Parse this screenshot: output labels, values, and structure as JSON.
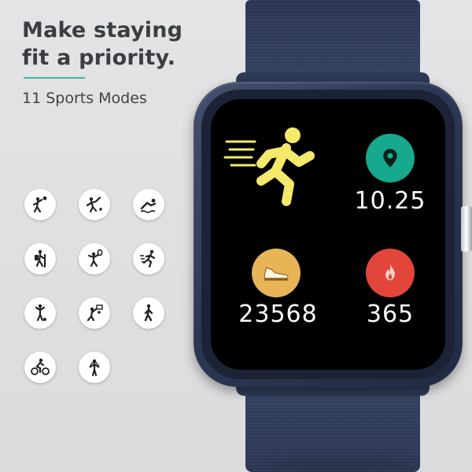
{
  "headline_line1": "Make staying",
  "headline_line2": "fit a priority.",
  "subtitle": "11 Sports Modes",
  "colors": {
    "accent_line": "#3bb3a3",
    "runner": "#f4e96b",
    "location": "#16a98e",
    "steps": "#e8b457",
    "calories": "#e2463a",
    "strap": "#2f3b58"
  },
  "sport_icons": [
    "volleyball-icon",
    "badminton-icon",
    "swimming-icon",
    "hiking-icon",
    "tennis-icon",
    "running-icon",
    "football-icon",
    "basketball-icon",
    "walking-icon",
    "cycling-icon",
    "jump-rope-icon"
  ],
  "watch": {
    "location_value": "10.25",
    "steps_value": "23568",
    "calories_value": "365"
  }
}
